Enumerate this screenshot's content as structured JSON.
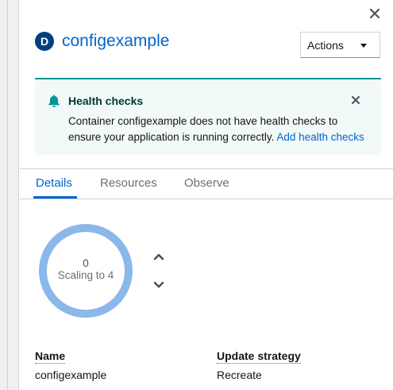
{
  "resource": {
    "badge": "D",
    "name": "configexample"
  },
  "header": {
    "actions_label": "Actions",
    "close_icon": "close-icon"
  },
  "alert": {
    "title": "Health checks",
    "message": "Container configexample does not have health checks to ensure your application is running correctly.",
    "link_text": "Add health checks",
    "icon": "bell-icon",
    "accent_color": "#009596"
  },
  "tabs": [
    {
      "label": "Details",
      "active": true
    },
    {
      "label": "Resources",
      "active": false
    },
    {
      "label": "Observe",
      "active": false
    }
  ],
  "pod_ring": {
    "count": "0",
    "status": "Scaling to 4",
    "ring_color": "#8bb8ea"
  },
  "details": {
    "name_label": "Name",
    "name_value": "configexample",
    "strategy_label": "Update strategy",
    "strategy_value": "Recreate"
  }
}
